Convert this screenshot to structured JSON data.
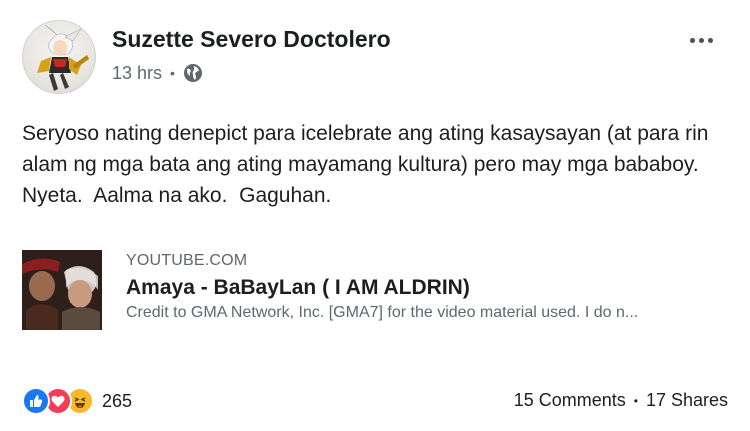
{
  "post": {
    "author": "Suzette Severo Doctolero",
    "time": "13 hrs",
    "separator": "•",
    "privacy_icon": "globe-icon",
    "more_icon": "more-options-icon",
    "text": "Seryoso nating denepict para icelebrate ang ating kasaysayan (at para rin alam ng mga bata ang ating mayamang kultura) pero may mga bababoy.   Nyeta.  Aalma na ako.  Gaguhan."
  },
  "link_preview": {
    "source": "YOUTUBE.COM",
    "title": "Amaya - BaBayLan ( I AM ALDRIN)",
    "description": "Credit to GMA Network, Inc. [GMA7] for the video material used. I do n..."
  },
  "engagement": {
    "reactions": [
      "like-icon",
      "love-icon",
      "haha-icon"
    ],
    "reaction_count": "265",
    "comments": "15 Comments",
    "separator": "•",
    "shares": "17 Shares"
  },
  "colors": {
    "like": "#1877f2",
    "love": "#f33e58",
    "haha": "#f7b928",
    "secondary_text": "#606770"
  }
}
